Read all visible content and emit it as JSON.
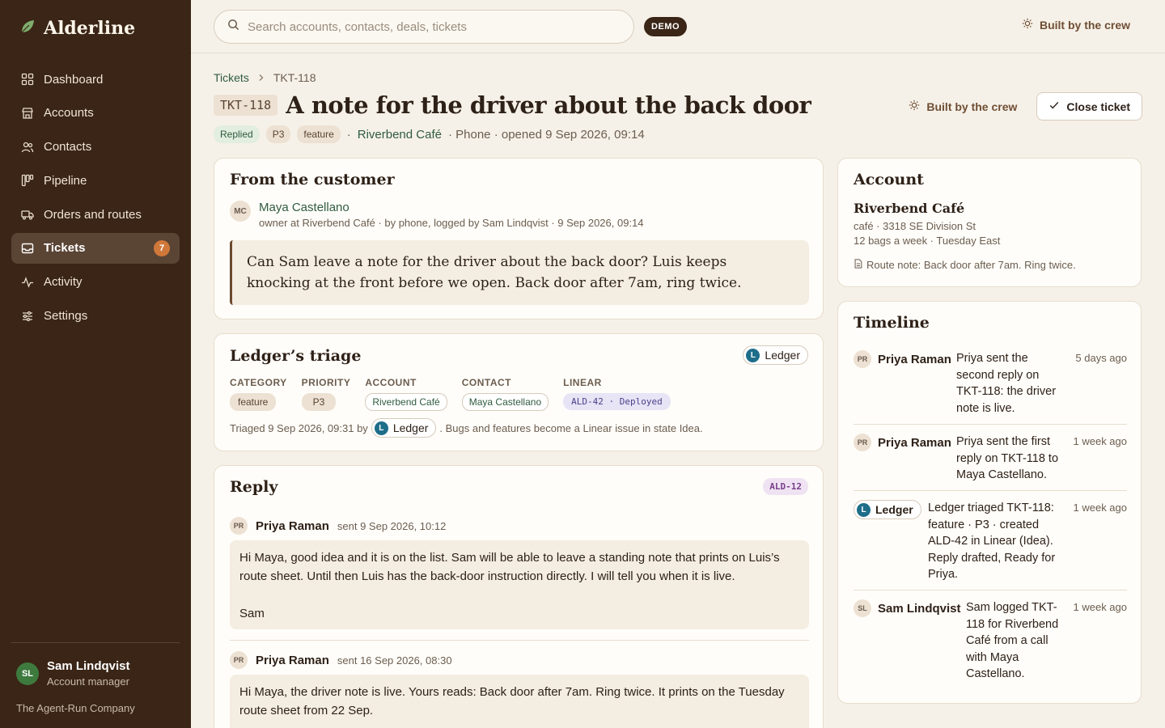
{
  "app": {
    "name": "Alderline"
  },
  "sidebar": {
    "items": [
      {
        "label": "Dashboard"
      },
      {
        "label": "Accounts"
      },
      {
        "label": "Contacts"
      },
      {
        "label": "Pipeline"
      },
      {
        "label": "Orders and routes"
      },
      {
        "label": "Tickets",
        "badge": "7"
      },
      {
        "label": "Activity"
      },
      {
        "label": "Settings"
      }
    ],
    "user": {
      "initials": "SL",
      "name": "Sam Lindqvist",
      "role": "Account manager"
    },
    "company": "The Agent-Run Company"
  },
  "topbar": {
    "search_placeholder": "Search accounts, contacts, deals, tickets",
    "demo": "DEMO",
    "crew": "Built by the crew"
  },
  "breadcrumb": {
    "parent": "Tickets",
    "current": "TKT-118"
  },
  "ticket": {
    "id": "TKT-118",
    "title": "A note for the driver about the back door",
    "status": "Replied",
    "priority": "P3",
    "category": "feature",
    "account": "Riverbend Café",
    "meta_rest": "· Phone · opened 9 Sep 2026, 09:14",
    "crew_label": "Built by the crew",
    "close_label": "Close ticket"
  },
  "customer": {
    "title": "From the customer",
    "initials": "MC",
    "name": "Maya Castellano",
    "meta": "owner at Riverbend Café · by phone, logged by Sam Lindqvist · 9 Sep 2026, 09:14",
    "quote": "Can Sam leave a note for the driver about the back door? Luis keeps knocking at the front before we open. Back door after 7am, ring twice."
  },
  "triage": {
    "title": "Ledger’s triage",
    "agent": "Ledger",
    "agent_initial": "L",
    "labels": {
      "category": "CATEGORY",
      "priority": "PRIORITY",
      "account": "ACCOUNT",
      "contact": "CONTACT",
      "linear": "LINEAR"
    },
    "values": {
      "category": "feature",
      "priority": "P3",
      "account": "Riverbend Café",
      "contact": "Maya Castellano",
      "linear": "ALD-42 · Deployed"
    },
    "foot_prefix": "Triaged 9 Sep 2026, 09:31 by",
    "foot_suffix": ". Bugs and features become a Linear issue in state Idea."
  },
  "reply": {
    "title": "Reply",
    "tag": "ALD-12",
    "messages": [
      {
        "initials": "PR",
        "author": "Priya Raman",
        "time": "sent 9 Sep 2026, 10:12",
        "body": "Hi Maya, good idea and it is on the list. Sam will be able to leave a standing note that prints on Luis’s route sheet. Until then Luis has the back-door instruction directly. I will tell you when it is live.",
        "signoff": "Sam"
      },
      {
        "initials": "PR",
        "author": "Priya Raman",
        "time": "sent 16 Sep 2026, 08:30",
        "body": "Hi Maya, the driver note is live. Yours reads: Back door after 7am. Ring twice. It prints on the Tuesday route sheet from 22 Sep."
      }
    ]
  },
  "account": {
    "title": "Account",
    "name": "Riverbend Café",
    "line1": "café · 3318 SE Division St",
    "line2": "12 bags a week · Tuesday East",
    "note": "Route note: Back door after 7am. Ring twice."
  },
  "timeline": {
    "title": "Timeline",
    "items": [
      {
        "initials": "PR",
        "who": "Priya Raman",
        "text": "Priya sent the second reply on TKT-118: the driver note is live.",
        "when": "5 days ago"
      },
      {
        "initials": "PR",
        "who": "Priya Raman",
        "text": "Priya sent the first reply on TKT-118 to Maya Castellano.",
        "when": "1 week ago"
      },
      {
        "initials": "L",
        "who": "Ledger",
        "text": "Ledger triaged TKT-118: feature · P3 · created ALD-42 in Linear (Idea). Reply drafted, Ready for Priya.",
        "when": "1 week ago"
      },
      {
        "initials": "SL",
        "who": "Sam Lindqvist",
        "text": "Sam logged TKT-118 for Riverbend Café from a call with Maya Castellano.",
        "when": "1 week ago"
      }
    ]
  }
}
